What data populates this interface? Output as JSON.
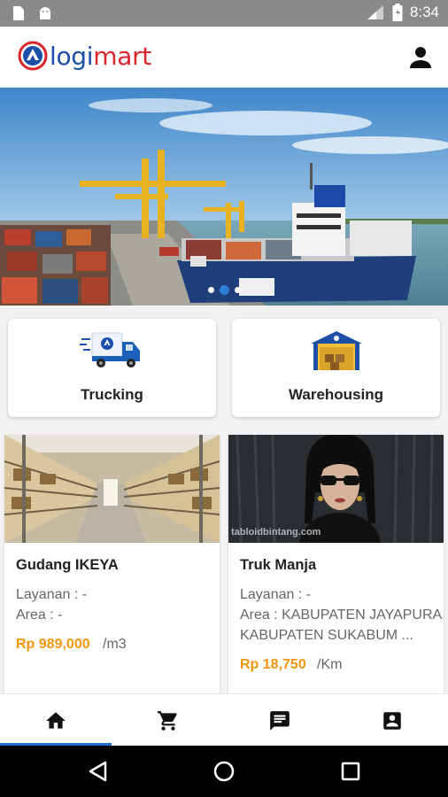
{
  "status_bar": {
    "time": "8:34",
    "icons": [
      "sd-card-icon",
      "android-icon",
      "signal-icon",
      "battery-icon"
    ]
  },
  "app_bar": {
    "logo_part1": "logi",
    "logo_part2": "mart",
    "profile_icon": "person-icon"
  },
  "banner": {
    "slide_count": 3,
    "active_slide": 2
  },
  "categories": [
    {
      "label": "Trucking",
      "icon": "truck-icon"
    },
    {
      "label": "Warehousing",
      "icon": "warehouse-icon"
    }
  ],
  "products": [
    {
      "name": "Gudang IKEYA",
      "layanan": "Layanan : -",
      "area_lines": [
        "Area : -"
      ],
      "price": "Rp 989,000",
      "unit": "/m3"
    },
    {
      "name": "Truk Manja",
      "layanan": "Layanan : -",
      "area_lines": [
        "Area : KABUPATEN JAYAPURA,",
        "KABUPATEN SUKABUM ..."
      ],
      "price": "Rp 18,750",
      "unit": "/Km",
      "watermark": "tabloidbintang.com"
    }
  ],
  "bottom_nav": {
    "items": [
      "home-icon",
      "cart-icon",
      "chat-icon",
      "account-box-icon"
    ],
    "active_index": 0
  },
  "system_nav": [
    "back-icon",
    "home-circle-icon",
    "recents-icon"
  ],
  "colors": {
    "brand_blue": "#1b4fa8",
    "brand_red": "#d9262c",
    "price_orange": "#f0960f",
    "accent_blue": "#1e6fd9"
  }
}
